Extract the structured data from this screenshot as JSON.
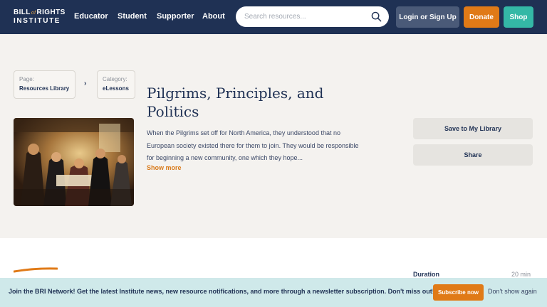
{
  "header": {
    "logo_line1_a": "BILL",
    "logo_line1_of": "of",
    "logo_line1_b": "RIGHTS",
    "logo_line2": "INSTITUTE",
    "nav": [
      "Educator",
      "Student",
      "Supporter",
      "About"
    ],
    "search_placeholder": "Search resources...",
    "search_icon": "search-icon",
    "login_label": "Login or Sign Up",
    "donate_label": "Donate",
    "shop_label": "Shop"
  },
  "breadcrumb": {
    "page_label": "Page:",
    "page_value": "Resources Library",
    "separator": "›",
    "category_label": "Category:",
    "category_value": "eLessons"
  },
  "lesson": {
    "title": "Pilgrims, Principles, and Politics",
    "description": "When the Pilgrims set off for North America, they understood that no European society existed there for them to join. They would be responsible for beginning a new community, one which they hope...",
    "show_more": "Show more",
    "image": "painting-of-pilgrims-signing-compact"
  },
  "actions": {
    "save_label": "Save to My Library",
    "share_label": "Share"
  },
  "details": {
    "duration_label": "Duration",
    "duration_value": "20 min"
  },
  "newsletter": {
    "text": "Join the BRI Network! Get the latest Institute news, new resource notifications, and more through a newsletter subscription. Don't miss out!",
    "subscribe_label": "Subscribe now",
    "dismiss_label": "Don't show again"
  },
  "colors": {
    "navy": "#1f3154",
    "orange": "#e07a17",
    "teal": "#34b8a6",
    "hero_bg": "#f4f2ef",
    "newsbar_bg": "#cfe9ea"
  }
}
